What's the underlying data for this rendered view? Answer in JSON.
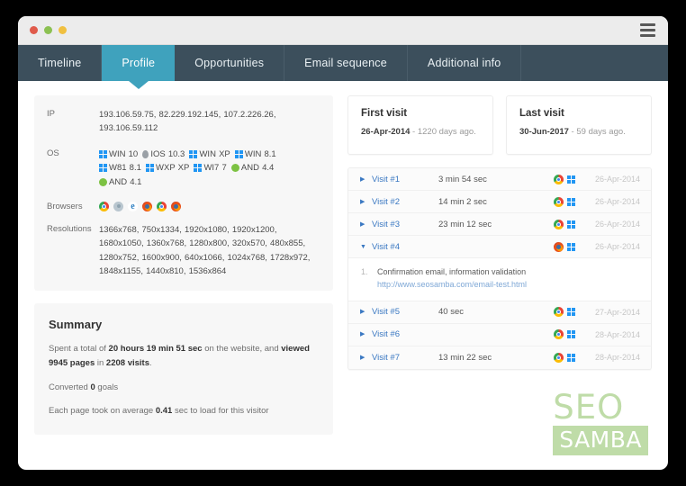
{
  "window": {
    "dots": [
      {
        "name": "close",
        "color": "#e05b4b"
      },
      {
        "name": "minimize",
        "color": "#8cc152"
      },
      {
        "name": "maximize",
        "color": "#f0c040"
      }
    ],
    "menu_icon": "hamburger-icon"
  },
  "tabs": [
    {
      "label": "Timeline",
      "active": false
    },
    {
      "label": "Profile",
      "active": true
    },
    {
      "label": "Opportunities",
      "active": false
    },
    {
      "label": "Email sequence",
      "active": false
    },
    {
      "label": "Additional info",
      "active": false
    }
  ],
  "profile": {
    "ip": {
      "label": "IP",
      "value": "193.106.59.75, 82.229.192.145, 107.2.226.26, 193.106.59.112"
    },
    "os": {
      "label": "OS",
      "items": [
        {
          "icon": "windows-icon",
          "text": "WIN 10"
        },
        {
          "icon": "apple-icon",
          "text": "IOS 10.3"
        },
        {
          "icon": "windows-icon",
          "text": "WIN XP"
        },
        {
          "icon": "windows-icon",
          "text": "WIN 8.1"
        },
        {
          "icon": "windows-icon",
          "text": "W81 8.1"
        },
        {
          "icon": "windows-icon",
          "text": "WXP XP"
        },
        {
          "icon": "windows-icon",
          "text": "WI7 7"
        },
        {
          "icon": "android-icon",
          "text": "AND 4.4"
        },
        {
          "icon": "android-icon",
          "text": "AND 4.1"
        }
      ]
    },
    "browsers": {
      "label": "Browsers",
      "items": [
        "chrome-icon",
        "safari-icon",
        "edge-icon",
        "firefox-icon",
        "chrome-icon",
        "firefox-icon"
      ]
    },
    "resolutions": {
      "label": "Resolutions",
      "value": "1366x768, 750x1334, 1920x1080, 1920x1200, 1680x1050, 1360x768, 1280x800, 320x570, 480x855, 1280x752, 1600x900, 640x1066, 1024x768, 1728x972, 1848x1155, 1440x810, 1536x864"
    }
  },
  "summary": {
    "title": "Summary",
    "line1_pre": "Spent a total of ",
    "line1_time": "20 hours 19 min 51 sec",
    "line1_mid": " on the website, and ",
    "line1_pages": "viewed 9945 pages",
    "line1_in": " in ",
    "line1_visits": "2208 visits",
    "line1_end": ".",
    "line2_pre": "Converted ",
    "line2_goals": "0",
    "line2_post": " goals",
    "line3_pre": "Each page took on average ",
    "line3_value": "0.41",
    "line3_post": " sec to load for this visitor"
  },
  "first_visit": {
    "title": "First visit",
    "date": "26-Apr-2014",
    "separator": " - ",
    "ago": "1220 days ago."
  },
  "last_visit": {
    "title": "Last visit",
    "date": "30-Jun-2017",
    "separator": " - ",
    "ago": "59 days ago."
  },
  "visits": [
    {
      "name": "Visit #1",
      "duration": "3 min 54 sec",
      "browser": "chrome-icon",
      "os": "windows-icon",
      "date": "26-Apr-2014",
      "expanded": false
    },
    {
      "name": "Visit #2",
      "duration": "14 min 2 sec",
      "browser": "chrome-icon",
      "os": "windows-icon",
      "date": "26-Apr-2014",
      "expanded": false
    },
    {
      "name": "Visit #3",
      "duration": "23 min 12 sec",
      "browser": "chrome-icon",
      "os": "windows-icon",
      "date": "26-Apr-2014",
      "expanded": false
    },
    {
      "name": "Visit #4",
      "duration": "",
      "browser": "firefox-icon",
      "os": "windows-icon",
      "date": "26-Apr-2014",
      "expanded": true,
      "detail": {
        "number": "1.",
        "title": "Confirmation email, information validation",
        "url": "http://www.seosamba.com/email-test.html"
      }
    },
    {
      "name": "Visit #5",
      "duration": "40 sec",
      "browser": "chrome-icon",
      "os": "windows-icon",
      "date": "27-Apr-2014",
      "expanded": false
    },
    {
      "name": "Visit #6",
      "duration": "",
      "browser": "chrome-icon",
      "os": "windows-icon",
      "date": "28-Apr-2014",
      "expanded": false
    },
    {
      "name": "Visit #7",
      "duration": "13 min 22 sec",
      "browser": "chrome-icon",
      "os": "windows-icon",
      "date": "28-Apr-2014",
      "expanded": false
    }
  ],
  "logo": {
    "top": "SEO",
    "bottom": "SAMBA",
    "color": "#bfdca8"
  },
  "colors": {
    "accent": "#3fa2bd",
    "tabbar": "#3c4f5c",
    "link": "#3a78c2"
  }
}
